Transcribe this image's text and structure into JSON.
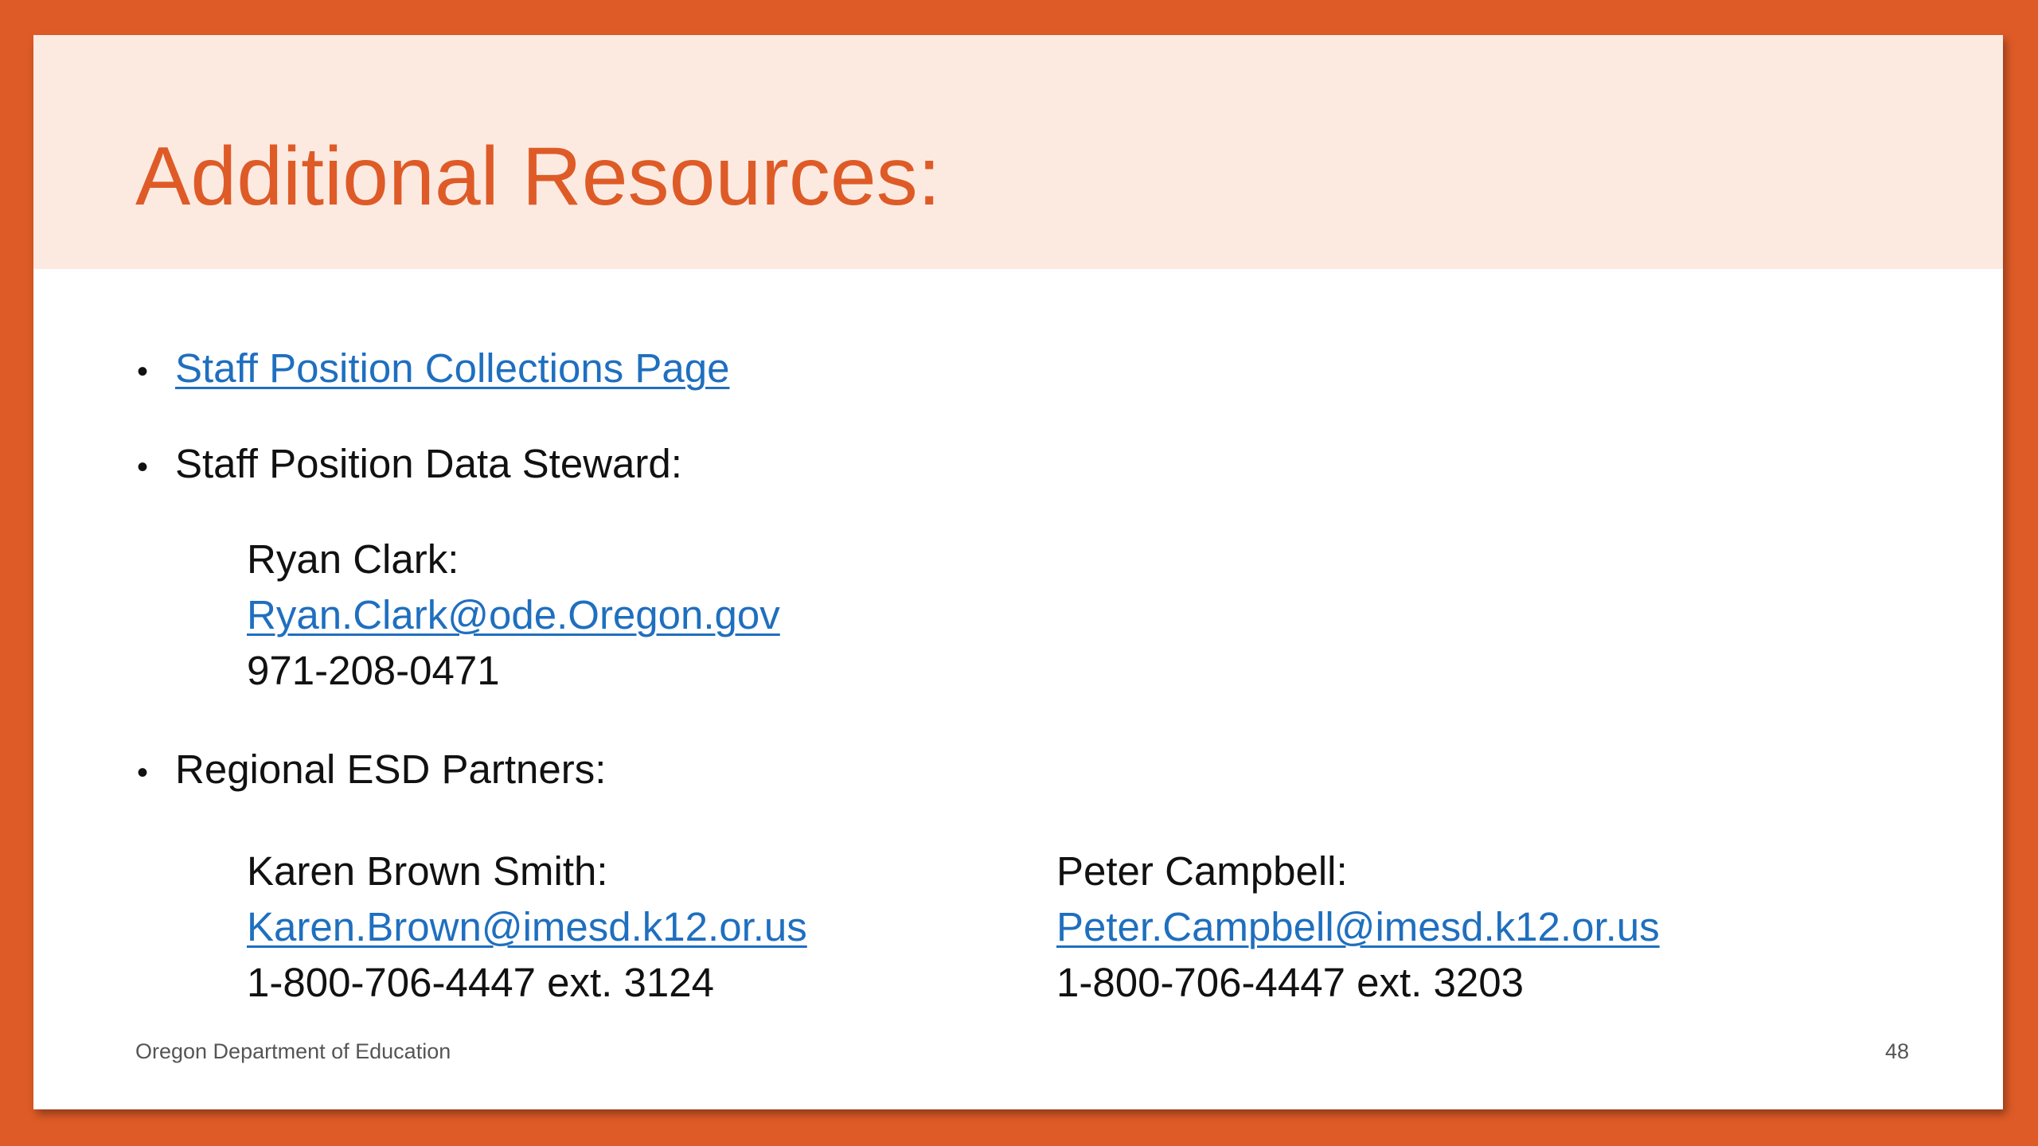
{
  "slide": {
    "title": "Additional Resources:",
    "bullets": [
      {
        "bullet": "•",
        "text": "Staff Position Collections Page"
      },
      {
        "bullet": "•",
        "text": "Staff Position Data Steward:"
      },
      {
        "bullet": "•",
        "text": "Regional ESD Partners:"
      }
    ],
    "steward": {
      "name": "Ryan Clark:",
      "email": "Ryan.Clark@ode.Oregon.gov",
      "phone": "971-208-0471"
    },
    "partners": [
      {
        "name": "Karen Brown Smith:",
        "email": "Karen.Brown@imesd.k12.or.us",
        "phone": "1-800-706-4447 ext. 3124"
      },
      {
        "name": "Peter Campbell:",
        "email": "Peter.Campbell@imesd.k12.or.us",
        "phone": "1-800-706-4447 ext. 3203"
      }
    ],
    "footer": {
      "organization": "Oregon Department of Education",
      "page_number": "48"
    }
  },
  "colors": {
    "accent": "#DE5B27",
    "header_band": "#FCEAE1",
    "link": "#1F6FBF",
    "text": "#111111"
  }
}
